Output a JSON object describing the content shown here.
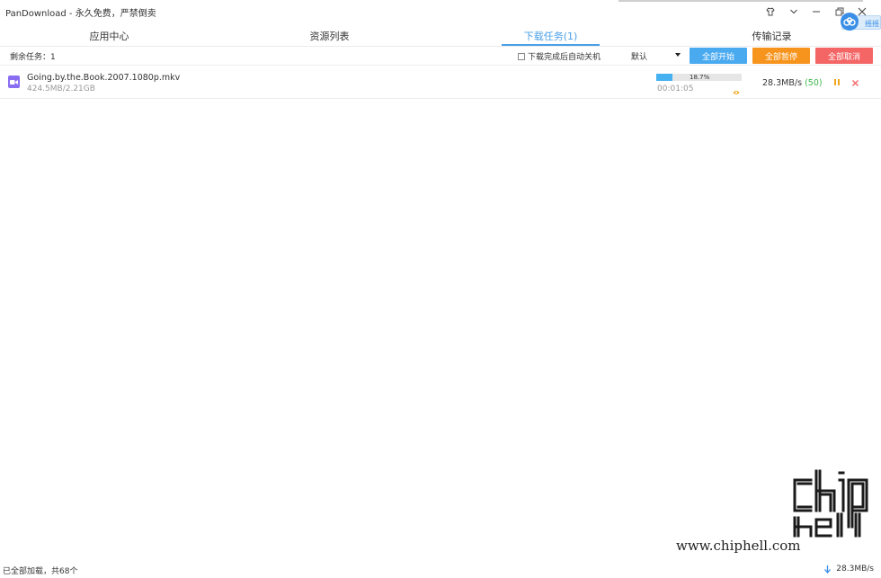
{
  "window": {
    "title": "PanDownload - 永久免费，严禁倒卖",
    "badge_text": "摇摇"
  },
  "tabs": [
    {
      "label": "应用中心",
      "active": false
    },
    {
      "label": "资源列表",
      "active": false
    },
    {
      "label": "下载任务(1)",
      "active": true
    },
    {
      "label": "传输记录",
      "active": false
    }
  ],
  "toolbar": {
    "remaining_label": "剩余任务：1",
    "shutdown_label": "下载完成后自动关机",
    "shutdown_checked": false,
    "select_value": "默认",
    "start_all_label": "全部开始",
    "pause_all_label": "全部暂停",
    "cancel_all_label": "全部取消"
  },
  "downloads": [
    {
      "name": "Going.by.the.Book.2007.1080p.mkv",
      "size_text": "424.5MB/2.21GB",
      "progress_text": "18.7%",
      "progress_value": 18.7,
      "elapsed": "00:01:05",
      "speed": "28.3MB/s",
      "connections": "(50)"
    }
  ],
  "status": {
    "left_text": "已全部加载，共68个",
    "speed_text": "28.3MB/s"
  },
  "watermark": {
    "url": "www.chiphell.com",
    "logo_text": "chip hell"
  },
  "colors": {
    "accent": "#4aa0e6",
    "start": "#4aaaf0",
    "pause": "#f7941d",
    "cancel": "#f46566",
    "progress": "#45b1f0",
    "connections": "#3bb54a"
  }
}
